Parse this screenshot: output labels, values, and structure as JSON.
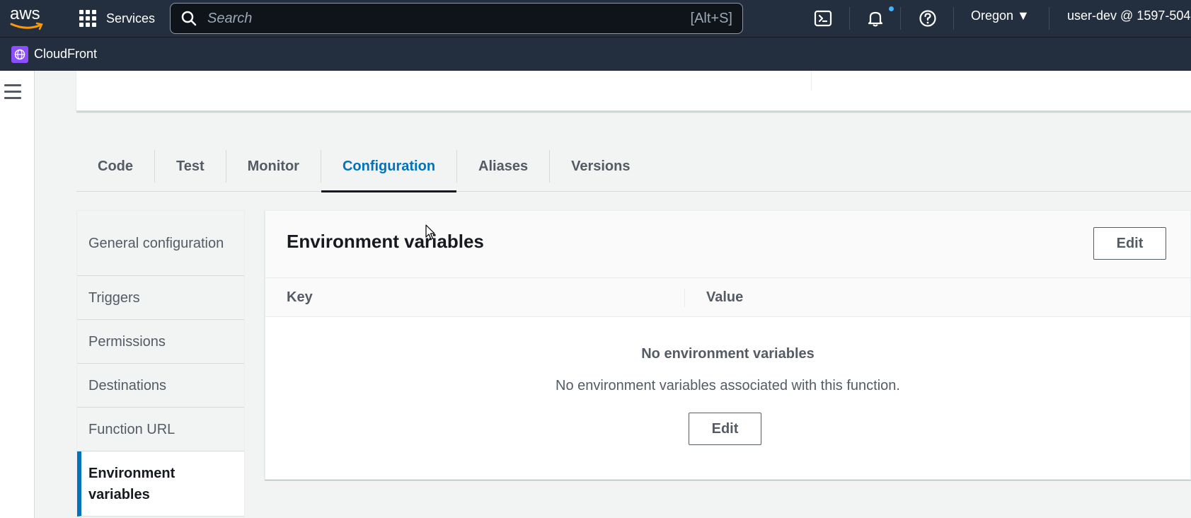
{
  "topnav": {
    "logo_text": "aws",
    "services_label": "Services",
    "search_placeholder": "Search",
    "search_shortcut": "[Alt+S]",
    "region": "Oregon ▼",
    "user": "user-dev @ 1597-504"
  },
  "subnav": {
    "service_name": "CloudFront"
  },
  "tabs": [
    {
      "label": "Code",
      "active": false
    },
    {
      "label": "Test",
      "active": false
    },
    {
      "label": "Monitor",
      "active": false
    },
    {
      "label": "Configuration",
      "active": true
    },
    {
      "label": "Aliases",
      "active": false
    },
    {
      "label": "Versions",
      "active": false
    }
  ],
  "sidemenu": [
    {
      "label": "General configuration",
      "active": false
    },
    {
      "label": "Triggers",
      "active": false
    },
    {
      "label": "Permissions",
      "active": false
    },
    {
      "label": "Destinations",
      "active": false
    },
    {
      "label": "Function URL",
      "active": false
    },
    {
      "label": "Environment variables",
      "active": true
    }
  ],
  "panel": {
    "title": "Environment variables",
    "edit_label": "Edit",
    "columns": [
      "Key",
      "Value"
    ],
    "empty_title": "No environment variables",
    "empty_desc": "No environment variables associated with this function.",
    "empty_edit_label": "Edit"
  },
  "colors": {
    "nav_bg": "#232f3e",
    "accent": "#0073bb",
    "cloudfront_badge": "#8c4fff"
  }
}
